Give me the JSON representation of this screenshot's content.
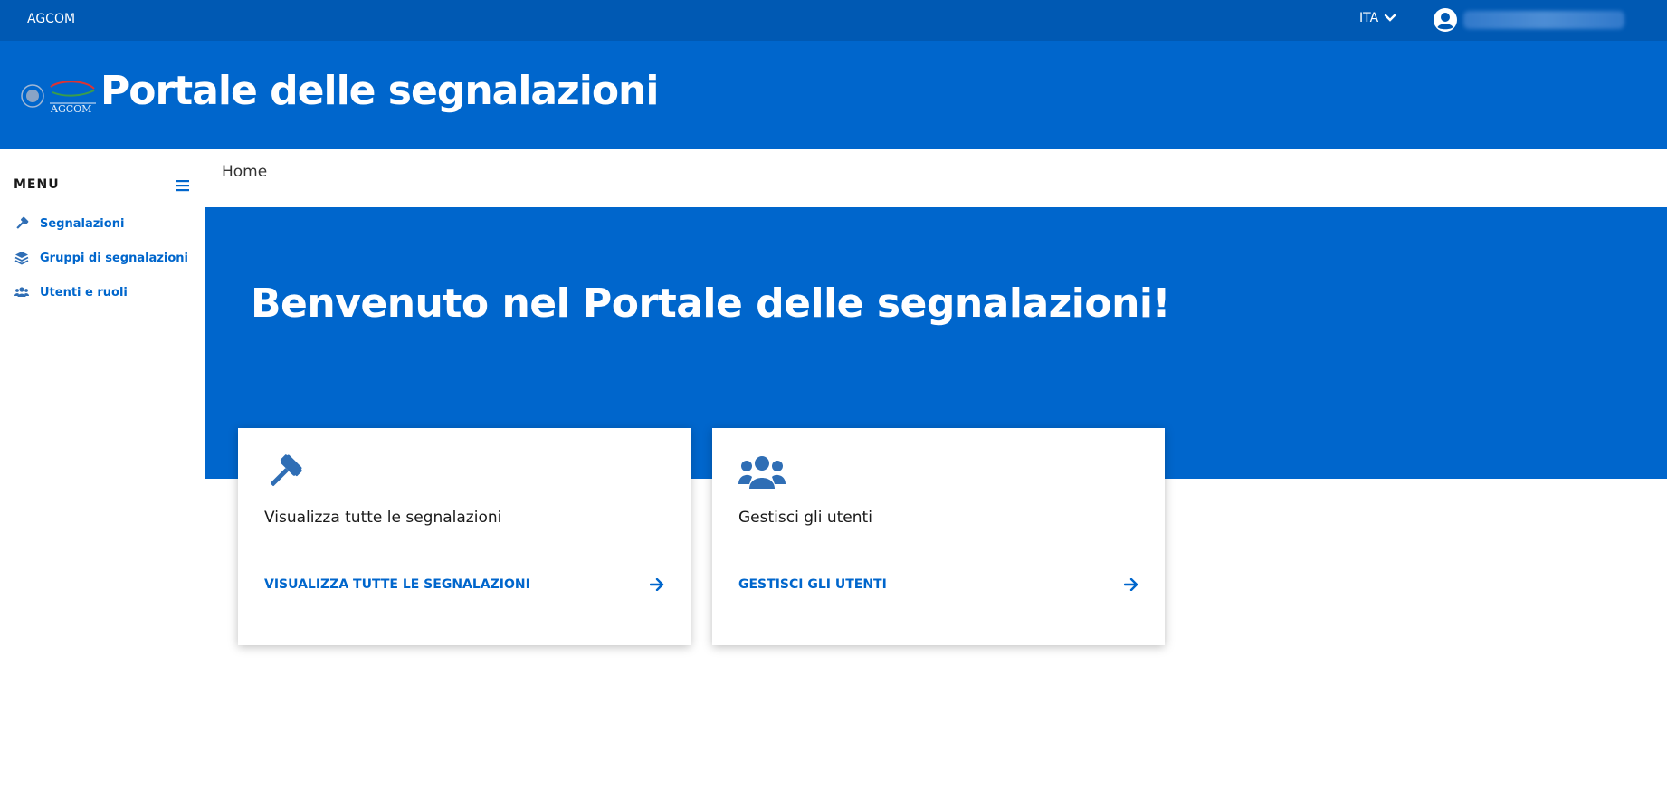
{
  "topbar": {
    "brand": "AGCOM",
    "language": "ITA"
  },
  "header": {
    "logo_text": "AGCOM",
    "title": "Portale delle segnalazioni"
  },
  "sidebar": {
    "menu_title": "MENU",
    "items": [
      {
        "label": "Segnalazioni",
        "icon": "gavel-icon"
      },
      {
        "label": "Gruppi di segnalazioni",
        "icon": "layers-icon"
      },
      {
        "label": "Utenti e ruoli",
        "icon": "users-icon"
      }
    ]
  },
  "breadcrumb": {
    "home": "Home"
  },
  "hero": {
    "title": "Benvenuto nel Portale delle segnalazioni!"
  },
  "cards": [
    {
      "icon": "gavel-icon",
      "text": "Visualizza tutte le segnalazioni",
      "link_label": "VISUALIZZA TUTTE LE SEGNALAZIONI"
    },
    {
      "icon": "users-icon",
      "text": "Gestisci gli utenti",
      "link_label": "GESTISCI GLI UTENTI"
    }
  ],
  "colors": {
    "topbar": "#0059b3",
    "primary": "#0066cc",
    "card_icon": "#2f6eb5"
  }
}
